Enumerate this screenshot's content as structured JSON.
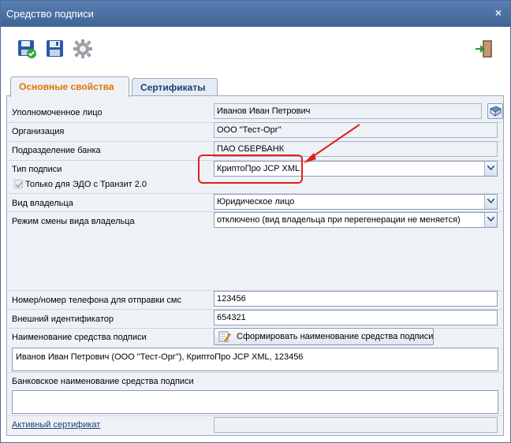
{
  "window": {
    "title": "Средство подписи",
    "close_glyph": "×"
  },
  "toolbar": {
    "buttons": [
      {
        "name": "save-and-close-icon"
      },
      {
        "name": "save-icon"
      },
      {
        "name": "settings-gear-icon"
      },
      {
        "name": "exit-icon"
      }
    ]
  },
  "tabs": [
    {
      "label": "Основные свойства",
      "active": true
    },
    {
      "label": "Сертификаты",
      "active": false
    }
  ],
  "form": {
    "authorized_person": {
      "label": "Уполномоченное лицо",
      "value": "Иванов Иван Петрович"
    },
    "organization": {
      "label": "Организация",
      "value": "ООО \"Тест-Орг\""
    },
    "bank_division": {
      "label": "Подразделение банка",
      "value": "ПАО СБЕРБАНК"
    },
    "signature_type": {
      "label": "Тип подписи",
      "value": "КриптоПро JCP XML"
    },
    "edo_transit_only": {
      "label": "Только для ЭДО с Транзит 2.0",
      "checked": true
    },
    "owner_type": {
      "label": "Вид владельца",
      "value": "Юридическое лицо"
    },
    "owner_change_mode": {
      "label": "Режим смены вида владельца",
      "value": "отключено (вид владельца при перегенерации не меняется)"
    },
    "sms_phone": {
      "label": "Номер/номер телефона для отправки смс",
      "value": "123456"
    },
    "external_id": {
      "label": "Внешний идентификатор",
      "value": "654321"
    },
    "tool_name": {
      "label": "Наименование средства подписи",
      "button_label": "Сформировать наименование средства подписи",
      "value": "Иванов Иван Петрович (ООО \"Тест-Орг\"), КриптоПро JCP XML, 123456"
    },
    "bank_tool_name": {
      "label": "Банковское наименование средства подписи",
      "value": ""
    },
    "active_certificate": {
      "label": "Активный сертификат",
      "value": ""
    }
  },
  "colors": {
    "title_bar": "#4a70a3",
    "active_tab_text": "#e07400",
    "annotation": "#e0201a"
  }
}
